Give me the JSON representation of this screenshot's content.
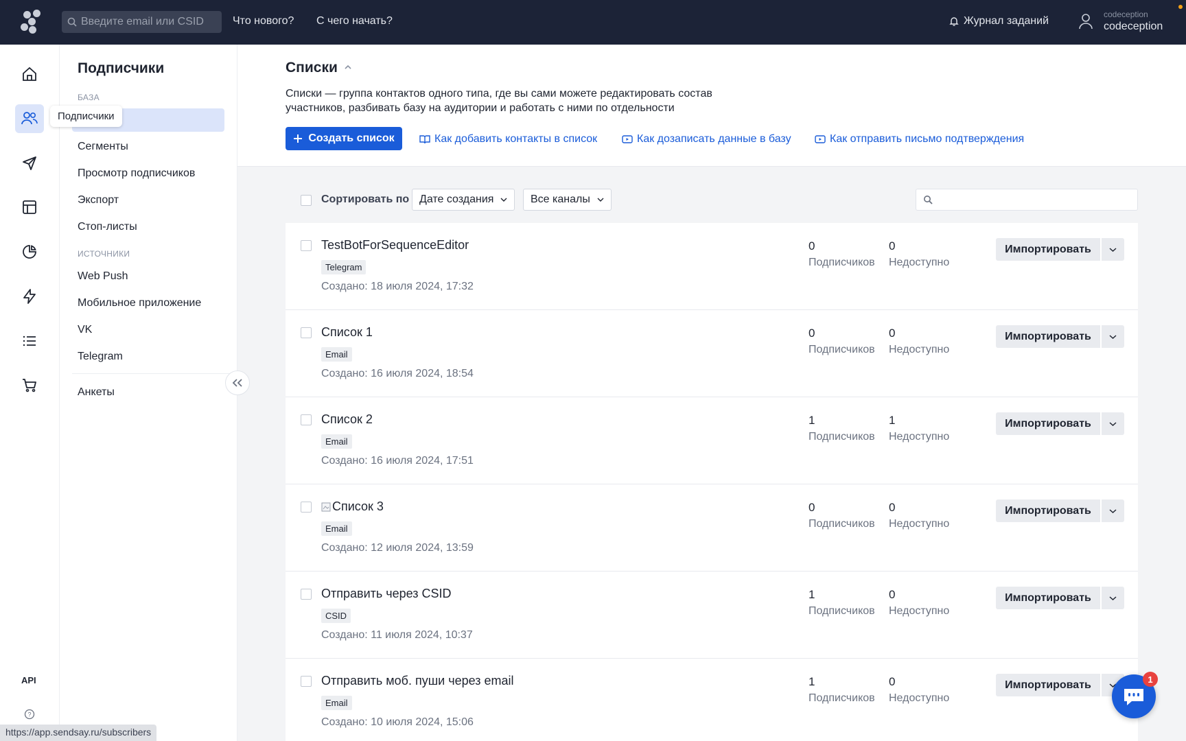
{
  "topbar": {
    "search_placeholder": "Введите email или CSID",
    "links": [
      "Что нового?",
      "С чего начать?"
    ],
    "jobs_label": "Журнал заданий",
    "account_small": "codeception",
    "account_name": "codeception"
  },
  "rail": {
    "tooltip": "Подписчики",
    "api_label": "API",
    "icons": [
      "home-icon",
      "users-icon",
      "send-icon",
      "layout-icon",
      "pie-chart-icon",
      "bolt-icon",
      "list-icon",
      "cart-icon"
    ]
  },
  "subnav": {
    "title": "Подписчики",
    "group_base": "БАЗА",
    "base_items": [
      "Сегменты",
      "Просмотр подписчиков",
      "Экспорт",
      "Стоп-листы"
    ],
    "group_sources": "ИСТОЧНИКИ",
    "source_items": [
      "Web Push",
      "Мобильное приложение",
      "VK",
      "Telegram"
    ],
    "forms": "Анкеты"
  },
  "header": {
    "title": "Списки",
    "description": "Списки — группа контактов одного типа, где вы сами можете редактировать состав участников, разбивать базу на аудитории и работать с ними по отдельности",
    "create_button": "Создать список",
    "help_links": [
      "Как добавить контакты в список",
      "Как дозаписать данные в базу",
      "Как отправить письмо подтверждения"
    ]
  },
  "filters": {
    "sort_label": "Сортировать по",
    "sort_value": "Дате создания",
    "channel_value": "Все каналы",
    "search_placeholder": ""
  },
  "lists": [
    {
      "title": "TestBotForSequenceEditor",
      "tag": "Telegram",
      "created": "Создано: 18 июля 2024, 17:32",
      "subscribers": "0",
      "unavailable": "0"
    },
    {
      "title": "Список 1",
      "tag": "Email",
      "created": "Создано: 16 июля 2024, 18:54",
      "subscribers": "0",
      "unavailable": "0"
    },
    {
      "title": "Список 2",
      "tag": "Email",
      "created": "Создано: 16 июля 2024, 17:51",
      "subscribers": "1",
      "unavailable": "1"
    },
    {
      "title": "Список 3",
      "tag": "Email",
      "created": "Создано: 12 июля 2024, 13:59",
      "subscribers": "0",
      "unavailable": "0"
    },
    {
      "title": "Отправить через CSID",
      "tag": "CSID",
      "created": "Создано: 11 июля 2024, 10:37",
      "subscribers": "1",
      "unavailable": "0"
    },
    {
      "title": "Отправить моб. пуши через email",
      "tag": "Email",
      "created": "Создано: 10 июля 2024, 15:06",
      "subscribers": "1",
      "unavailable": "0"
    }
  ],
  "labels": {
    "subscribers_caption": "Подписчиков",
    "unavailable_caption": "Недоступно",
    "import_button": "Импортировать"
  },
  "chat": {
    "badge": "1"
  },
  "status_url": "https://app.sendsay.ru/subscribers",
  "colors": {
    "accent": "#1a5cd9",
    "topbar": "#1c2337",
    "selection": "#dbe4fa",
    "badge": "#e8423f"
  }
}
